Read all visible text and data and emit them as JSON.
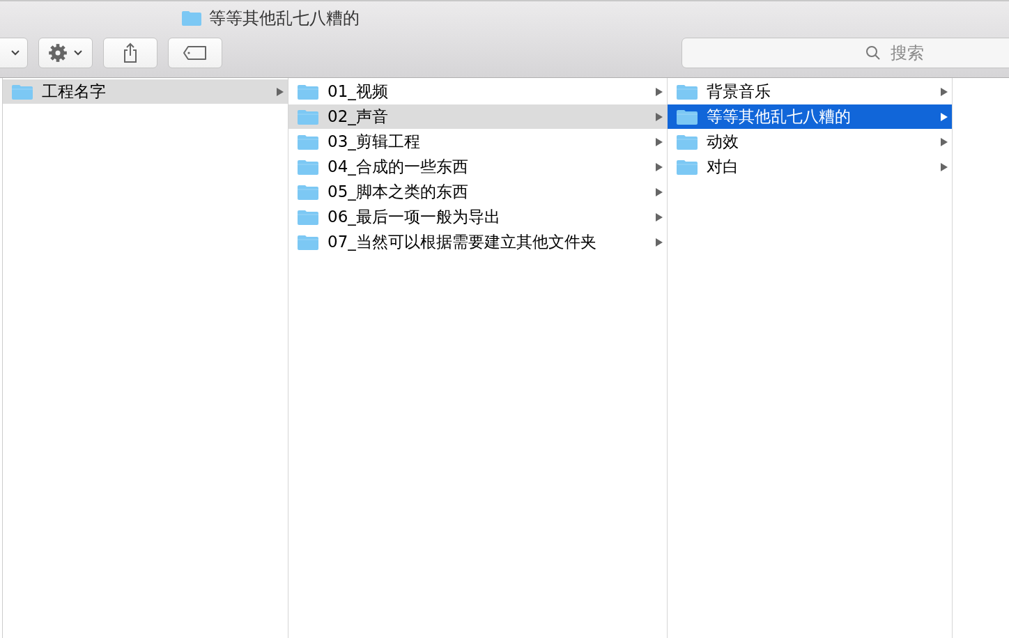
{
  "window": {
    "title": "等等其他乱七八糟的"
  },
  "toolbar": {
    "buttons": [
      {
        "kind": "view"
      },
      {
        "kind": "action"
      },
      {
        "kind": "share"
      },
      {
        "kind": "tag"
      }
    ]
  },
  "search": {
    "placeholder": "搜索"
  },
  "columns": [
    {
      "active": false,
      "items": [
        {
          "name": "工程名字",
          "selected": true
        }
      ]
    },
    {
      "active": false,
      "items": [
        {
          "name": "01_视频",
          "selected": false
        },
        {
          "name": "02_声音",
          "selected": true
        },
        {
          "name": "03_剪辑工程",
          "selected": false
        },
        {
          "name": "04_合成的一些东西",
          "selected": false
        },
        {
          "name": "05_脚本之类的东西",
          "selected": false
        },
        {
          "name": "06_最后一项一般为导出",
          "selected": false
        },
        {
          "name": "07_当然可以根据需要建立其他文件夹",
          "selected": false
        }
      ]
    },
    {
      "active": true,
      "items": [
        {
          "name": "背景音乐",
          "selected": false
        },
        {
          "name": "等等其他乱七八糟的",
          "selected": true
        },
        {
          "name": "动效",
          "selected": false
        },
        {
          "name": "对白",
          "selected": false
        }
      ]
    }
  ]
}
